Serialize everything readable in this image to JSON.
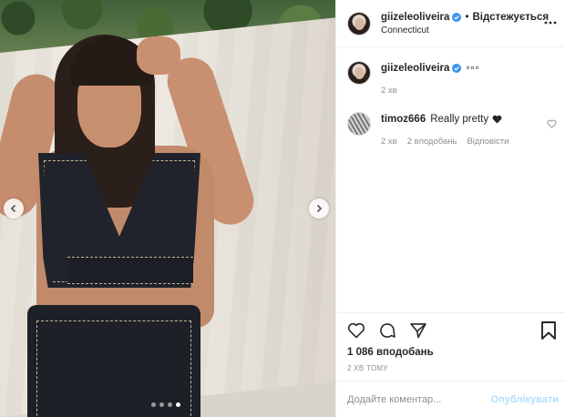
{
  "post": {
    "author": {
      "username": "giizeleoliveira",
      "verified": true,
      "separator": "•",
      "follow_status": "Відстежується",
      "location": "Connecticut"
    },
    "caption": {
      "username": "giizeleoliveira",
      "text": "▫▫▫",
      "time": "2 хв"
    },
    "comments": [
      {
        "username": "timoz666",
        "text": "Really pretty",
        "time": "2 хв",
        "likes": "2 вподобань",
        "reply": "Відповісти"
      }
    ],
    "likes_count": "1 086 вподобань",
    "timestamp": "2 ХВ ТОМУ",
    "add_comment": {
      "placeholder": "Додайте коментар...",
      "publish": "Опублікувати"
    },
    "carousel": {
      "total": 4,
      "active_index": 3
    }
  },
  "icons": {
    "more": "more-options-icon",
    "like": "heart-icon",
    "comment": "comment-icon",
    "share": "share-icon",
    "save": "bookmark-icon",
    "verified": "verified-badge-icon",
    "prev": "chevron-left-icon",
    "next": "chevron-right-icon"
  },
  "colors": {
    "verified": "#3897f0",
    "publish": "#b2dffc",
    "muted": "#8e8e8e",
    "text": "#262626"
  }
}
